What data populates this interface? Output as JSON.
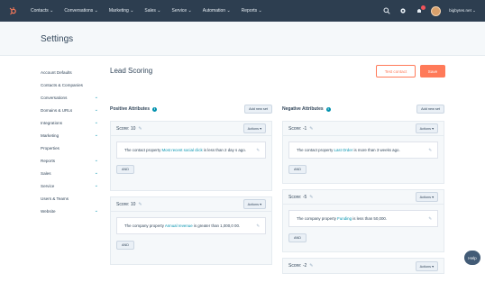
{
  "nav": {
    "items": [
      "Contacts ⌄",
      "Conversations ⌄",
      "Marketing ⌄",
      "Sales ⌄",
      "Service ⌄",
      "Automation ⌄",
      "Reports ⌄"
    ],
    "account": "bigbytes.net ⌄",
    "notification_badge": ""
  },
  "header": {
    "title": "Settings"
  },
  "sidebar": {
    "items": [
      {
        "label": "Account Defaults",
        "chevron": ""
      },
      {
        "label": "Contacts & Companies",
        "chevron": ""
      },
      {
        "label": "Conversations",
        "chevron": "⌄"
      },
      {
        "label": "Domains & URLs",
        "chevron": "⌄"
      },
      {
        "label": "Integrations",
        "chevron": "⌄"
      },
      {
        "label": "Marketing",
        "chevron": "⌄"
      },
      {
        "label": "Properties",
        "chevron": ""
      },
      {
        "label": "Reports",
        "chevron": "⌄"
      },
      {
        "label": "Sales",
        "chevron": "⌄"
      },
      {
        "label": "Service",
        "chevron": "⌄"
      },
      {
        "label": "Users & Teams",
        "chevron": ""
      },
      {
        "label": "Website",
        "chevron": "⌄"
      }
    ]
  },
  "main": {
    "title": "Lead Scoring",
    "test_label": "Test contact",
    "save_label": "Save"
  },
  "positive": {
    "title": "Positive Attributes",
    "add_label": "Add new set",
    "cards": [
      {
        "score": "Score: 10",
        "actions": "Actions ▾",
        "pre": "The contact property ",
        "link": "Most recent social click",
        "post": " is less than 2 day s ago.",
        "and": "AND"
      },
      {
        "score": "Score: 10",
        "actions": "Actions ▾",
        "pre": "The company property ",
        "link": "Annual revenue",
        "post": " is greater than 1,000,0 00.",
        "and": "AND"
      }
    ]
  },
  "negative": {
    "title": "Negative Attributes",
    "add_label": "Add new set",
    "cards": [
      {
        "score": "Score: -1",
        "actions": "Actions ▾",
        "pre": "The contact property ",
        "link": "Last Order",
        "post": " is more than 3 weeks ago.",
        "and": "AND"
      },
      {
        "score": "Score: -5",
        "actions": "Actions ▾",
        "pre": "The company property ",
        "link": "Funding",
        "post": " is less than 50,000.",
        "and": "AND"
      },
      {
        "score": "Score: -2",
        "actions": "Actions ▾"
      }
    ]
  },
  "help_label": "Help",
  "colors": {
    "accent": "#ff7a59",
    "nav_bg": "#2d3e50",
    "link": "#0091ae"
  }
}
